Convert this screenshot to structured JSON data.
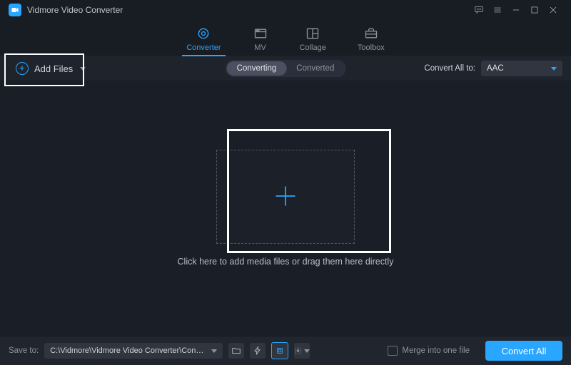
{
  "app": {
    "title": "Vidmore Video Converter"
  },
  "window_icons": {
    "feedback": "feedback-icon",
    "menu": "menu-icon",
    "minimize": "minimize-icon",
    "maximize": "maximize-icon",
    "close": "close-icon"
  },
  "tabs": {
    "items": [
      {
        "label": "Converter",
        "icon": "converter-icon",
        "active": true
      },
      {
        "label": "MV",
        "icon": "mv-icon",
        "active": false
      },
      {
        "label": "Collage",
        "icon": "collage-icon",
        "active": false
      },
      {
        "label": "Toolbox",
        "icon": "toolbox-icon",
        "active": false
      }
    ]
  },
  "toolbar": {
    "add_files_label": "Add Files",
    "mode": {
      "options": [
        "Converting",
        "Converted"
      ],
      "active": "Converting"
    },
    "convert_all_to_label": "Convert All to:",
    "output_format": "AAC"
  },
  "main": {
    "hint": "Click here to add media files or drag them here directly"
  },
  "footer": {
    "save_to_label": "Save to:",
    "save_path": "C:\\Vidmore\\Vidmore Video Converter\\Converted",
    "buttons": {
      "open_folder": "open-folder-icon",
      "high_speed": "high-speed-icon",
      "gpu": "gpu-accel-icon",
      "settings": "settings-gear-icon"
    },
    "merge_label": "Merge into one file",
    "merge_checked": false,
    "convert_all_label": "Convert All"
  },
  "colors": {
    "accent": "#29a6ff",
    "background": "#1a1e26"
  }
}
